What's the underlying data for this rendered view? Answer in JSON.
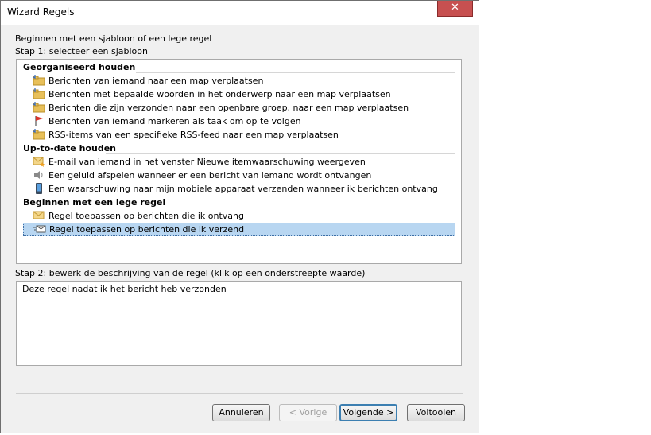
{
  "window": {
    "title": "Wizard Regels",
    "close_glyph": "✕"
  },
  "intro": {
    "heading": "Beginnen met een sjabloon of een lege regel",
    "step1": "Stap 1: selecteer een sjabloon"
  },
  "groups": [
    {
      "header": "Georganiseerd houden",
      "items": [
        {
          "label": "Berichten van iemand naar een map verplaatsen",
          "icon": "folder-move-icon"
        },
        {
          "label": "Berichten met bepaalde woorden in het onderwerp naar een map verplaatsen",
          "icon": "folder-move-icon"
        },
        {
          "label": "Berichten die zijn verzonden naar een openbare groep, naar een map verplaatsen",
          "icon": "folder-move-icon"
        },
        {
          "label": "Berichten van iemand markeren als taak om op te volgen",
          "icon": "red-flag-icon"
        },
        {
          "label": "RSS-items van een specifieke RSS-feed naar een map verplaatsen",
          "icon": "folder-move-icon"
        }
      ]
    },
    {
      "header": "Up-to-date houden",
      "items": [
        {
          "label": "E-mail van iemand in het venster Nieuwe itemwaarschuwing weergeven",
          "icon": "envelope-star-icon"
        },
        {
          "label": "Een geluid afspelen wanneer er een bericht van iemand wordt ontvangen",
          "icon": "speaker-icon"
        },
        {
          "label": "Een waarschuwing naar mijn mobiele apparaat verzenden wanneer ik berichten ontvang",
          "icon": "mobile-phone-icon"
        }
      ]
    },
    {
      "header": "Beginnen met een lege regel",
      "items": [
        {
          "label": "Regel toepassen op berichten die ik ontvang",
          "icon": "envelope-icon"
        },
        {
          "label": "Regel toepassen op berichten die ik verzend",
          "icon": "send-mail-icon",
          "selected": true
        }
      ]
    }
  ],
  "step2": {
    "label": "Stap 2: bewerk de beschrijving van de regel (klik op een onderstreepte waarde)",
    "description": "Deze regel nadat ik het bericht heb verzonden"
  },
  "buttons": {
    "cancel": "Annuleren",
    "back": "< Vorige",
    "next": "Volgende >",
    "finish": "Voltooien"
  },
  "colors": {
    "selection": "#b8d6f1",
    "close": "#c75050",
    "default_button_border": "#3c7fb1"
  }
}
